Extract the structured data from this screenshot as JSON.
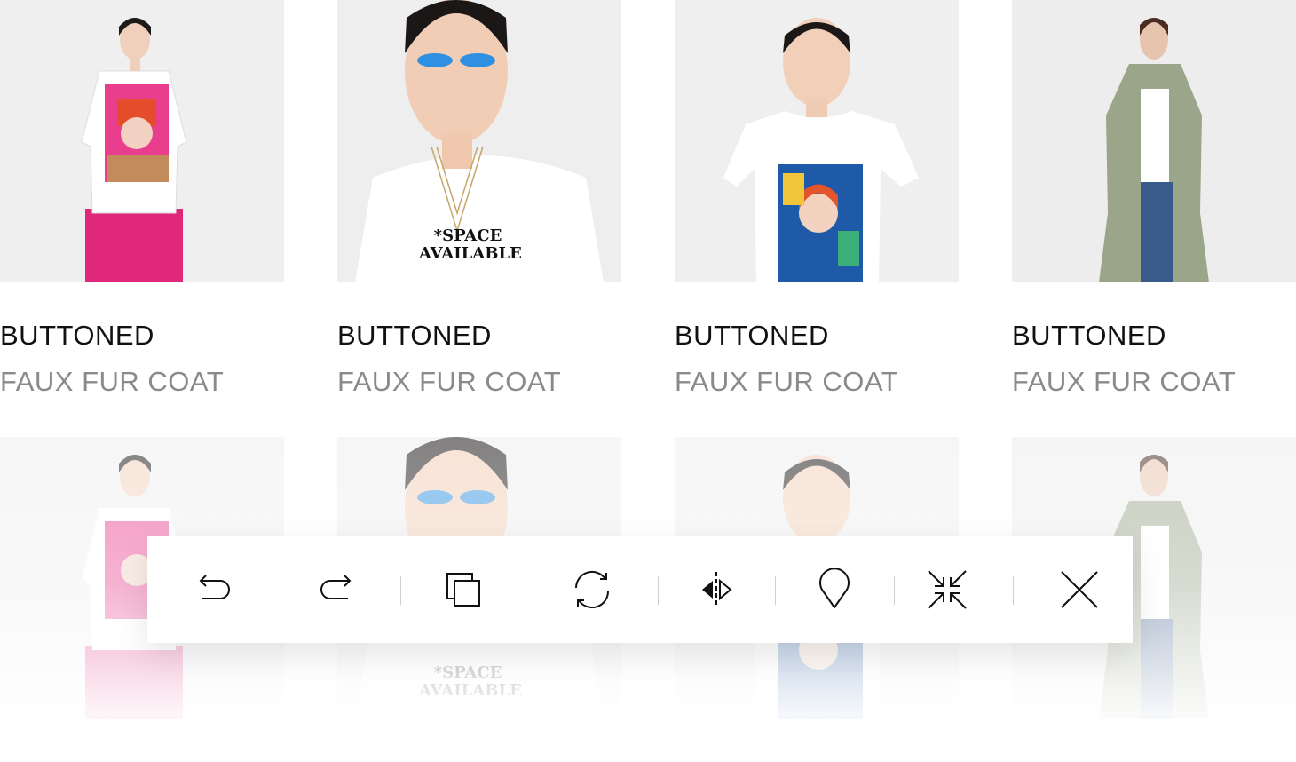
{
  "products": [
    {
      "line1": "BUTTONED",
      "line2": "FAUX FUR COAT",
      "photo": "woman-pink-skirt-graphic-tee"
    },
    {
      "line1": "BUTTONED",
      "line2": "FAUX FUR COAT",
      "photo": "woman-blue-eyeshadow-space-available-tee"
    },
    {
      "line1": "BUTTONED",
      "line2": "FAUX FUR COAT",
      "photo": "woman-tropical-print-tee"
    },
    {
      "line1": "BUTTONED",
      "line2": "FAUX FUR COAT",
      "photo": "woman-green-trench-coat"
    }
  ],
  "tee_print_text": "*SPACE AVAILABLE",
  "toolbar": {
    "tools": [
      {
        "name": "undo",
        "icon": "undo-icon"
      },
      {
        "name": "redo",
        "icon": "redo-icon"
      },
      {
        "name": "duplicate",
        "icon": "duplicate-icon"
      },
      {
        "name": "rotate",
        "icon": "rotate-icon"
      },
      {
        "name": "flip",
        "icon": "flip-icon"
      },
      {
        "name": "pin",
        "icon": "pin-icon"
      },
      {
        "name": "shrink",
        "icon": "shrink-icon"
      },
      {
        "name": "close",
        "icon": "close-icon"
      }
    ]
  },
  "colors": {
    "title": "#111111",
    "subtitle": "#8a8a8a",
    "photo_bg": "#ededed",
    "separator": "#cfcfcf"
  }
}
